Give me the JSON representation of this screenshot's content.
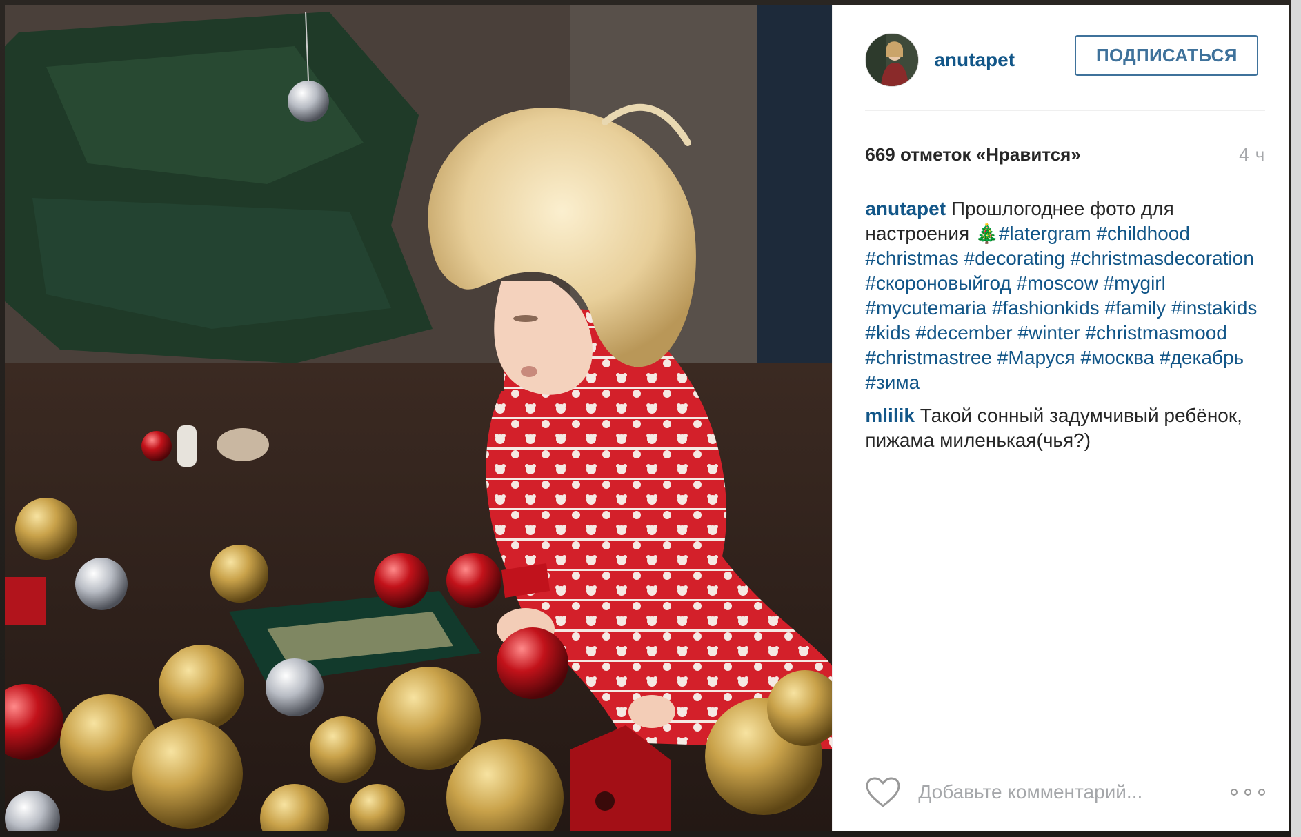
{
  "post": {
    "author": "anutapet",
    "follow_label": "ПОДПИСАТЬСЯ",
    "likes": "669 отметок «Нравится»",
    "time": "4 ч"
  },
  "caption": {
    "user": "anutapet",
    "text": "Прошлогоднее фото для настроения 🎄",
    "hashtags": [
      "#latergram",
      "#childhood",
      "#christmas",
      "#decorating",
      "#christmasdecoration",
      "#скороновыйгод",
      "#moscow",
      "#mygirl",
      "#mycutemaria",
      "#fashionkids",
      "#family",
      "#instakids",
      "#kids",
      "#december",
      "#winter",
      "#christmasmood",
      "#christmastree",
      "#Маруся",
      "#москва",
      "#декабрь",
      "#зима"
    ]
  },
  "comment": {
    "user": "mlilik",
    "text": "Такой сонный задумчивый ребёнок, пижама миленькая(чья?)"
  },
  "footer": {
    "placeholder": "Добавьте комментарий..."
  },
  "icons": {
    "like": "heart-outline-icon",
    "more": "more-options-icon"
  },
  "colors": {
    "link": "#125688",
    "follow": "#3f729b",
    "muted": "#a5a7aa"
  }
}
